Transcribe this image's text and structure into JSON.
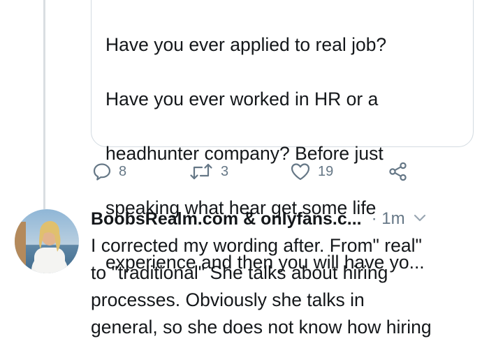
{
  "quoted_tweet": {
    "lines": [
      "Have you ever applied to real job?",
      "Have you ever worked in HR or a",
      "headhunter company? Before just",
      "speaking what hear get some life",
      "experience and then you will have yo..."
    ]
  },
  "actions": {
    "reply_count": "8",
    "retweet_count": "3",
    "like_count": "19"
  },
  "reply_tweet": {
    "author_name": "BoobsRealm.com & onlyfans.c...",
    "time": "· 1m",
    "lines": [
      "I corrected my wording after. From\" real\"",
      "to \"traditional\" She talks about hiring",
      "processes. Obviously she talks in",
      "general, so she does not know how hiring"
    ]
  },
  "colors": {
    "text": "#14171a",
    "muted": "#657786",
    "border": "#d3dbe1"
  },
  "icons": [
    "reply-icon",
    "retweet-icon",
    "like-icon",
    "share-icon",
    "chevron-down-icon"
  ]
}
